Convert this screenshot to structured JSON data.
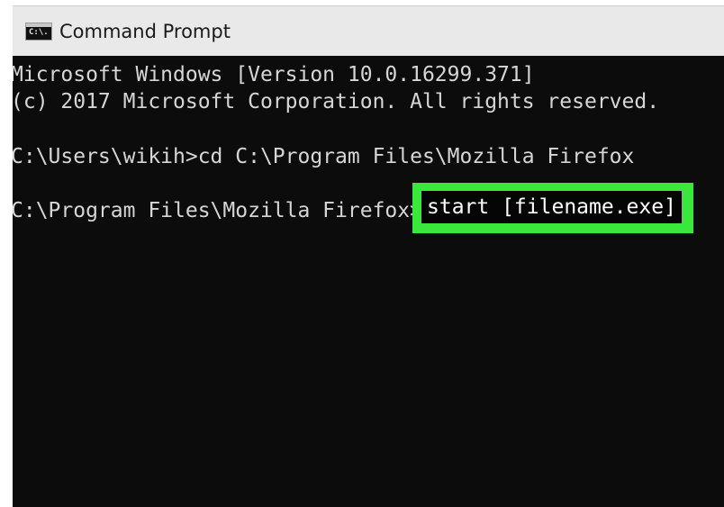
{
  "window": {
    "title": "Command Prompt",
    "icon": "cmd-icon",
    "icon_label": "C:\\."
  },
  "console": {
    "lines": [
      "Microsoft Windows [Version 10.0.16299.371]",
      "(c) 2017 Microsoft Corporation. All rights reserved.",
      "C:\\Users\\wikih>cd C:\\Program Files\\Mozilla Firefox",
      "C:\\Program Files\\Mozilla Firefox>"
    ],
    "highlighted_command": "start [filename.exe]"
  },
  "colors": {
    "background": "#0c0c0c",
    "text": "#d6d6d6",
    "highlight": "#39e83a",
    "titlebar": "#e9e9e9"
  }
}
